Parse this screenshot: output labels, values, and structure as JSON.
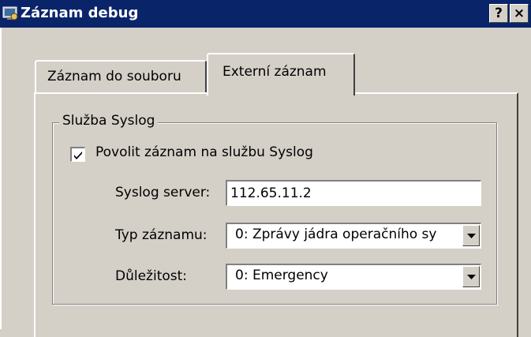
{
  "window": {
    "title": "Záznam debug",
    "help_button": "?",
    "close_button": "×"
  },
  "tabs": [
    {
      "label": "Záznam do souboru",
      "selected": false
    },
    {
      "label": "Externí záznam",
      "selected": true
    }
  ],
  "syslog_group": {
    "title": "Služba Syslog",
    "enable_checkbox": {
      "label": "Povolit záznam na službu Syslog",
      "checked": true
    },
    "server": {
      "label": "Syslog server:",
      "value": "112.65.11.2"
    },
    "log_type": {
      "label": "Typ záznamu:",
      "value": "0: Zprávy jádra operačního sy"
    },
    "severity": {
      "label": "Důležitost:",
      "value": "0: Emergency"
    }
  },
  "colors": {
    "title_bar": "#0a246a",
    "face": "#d4d0c8"
  }
}
